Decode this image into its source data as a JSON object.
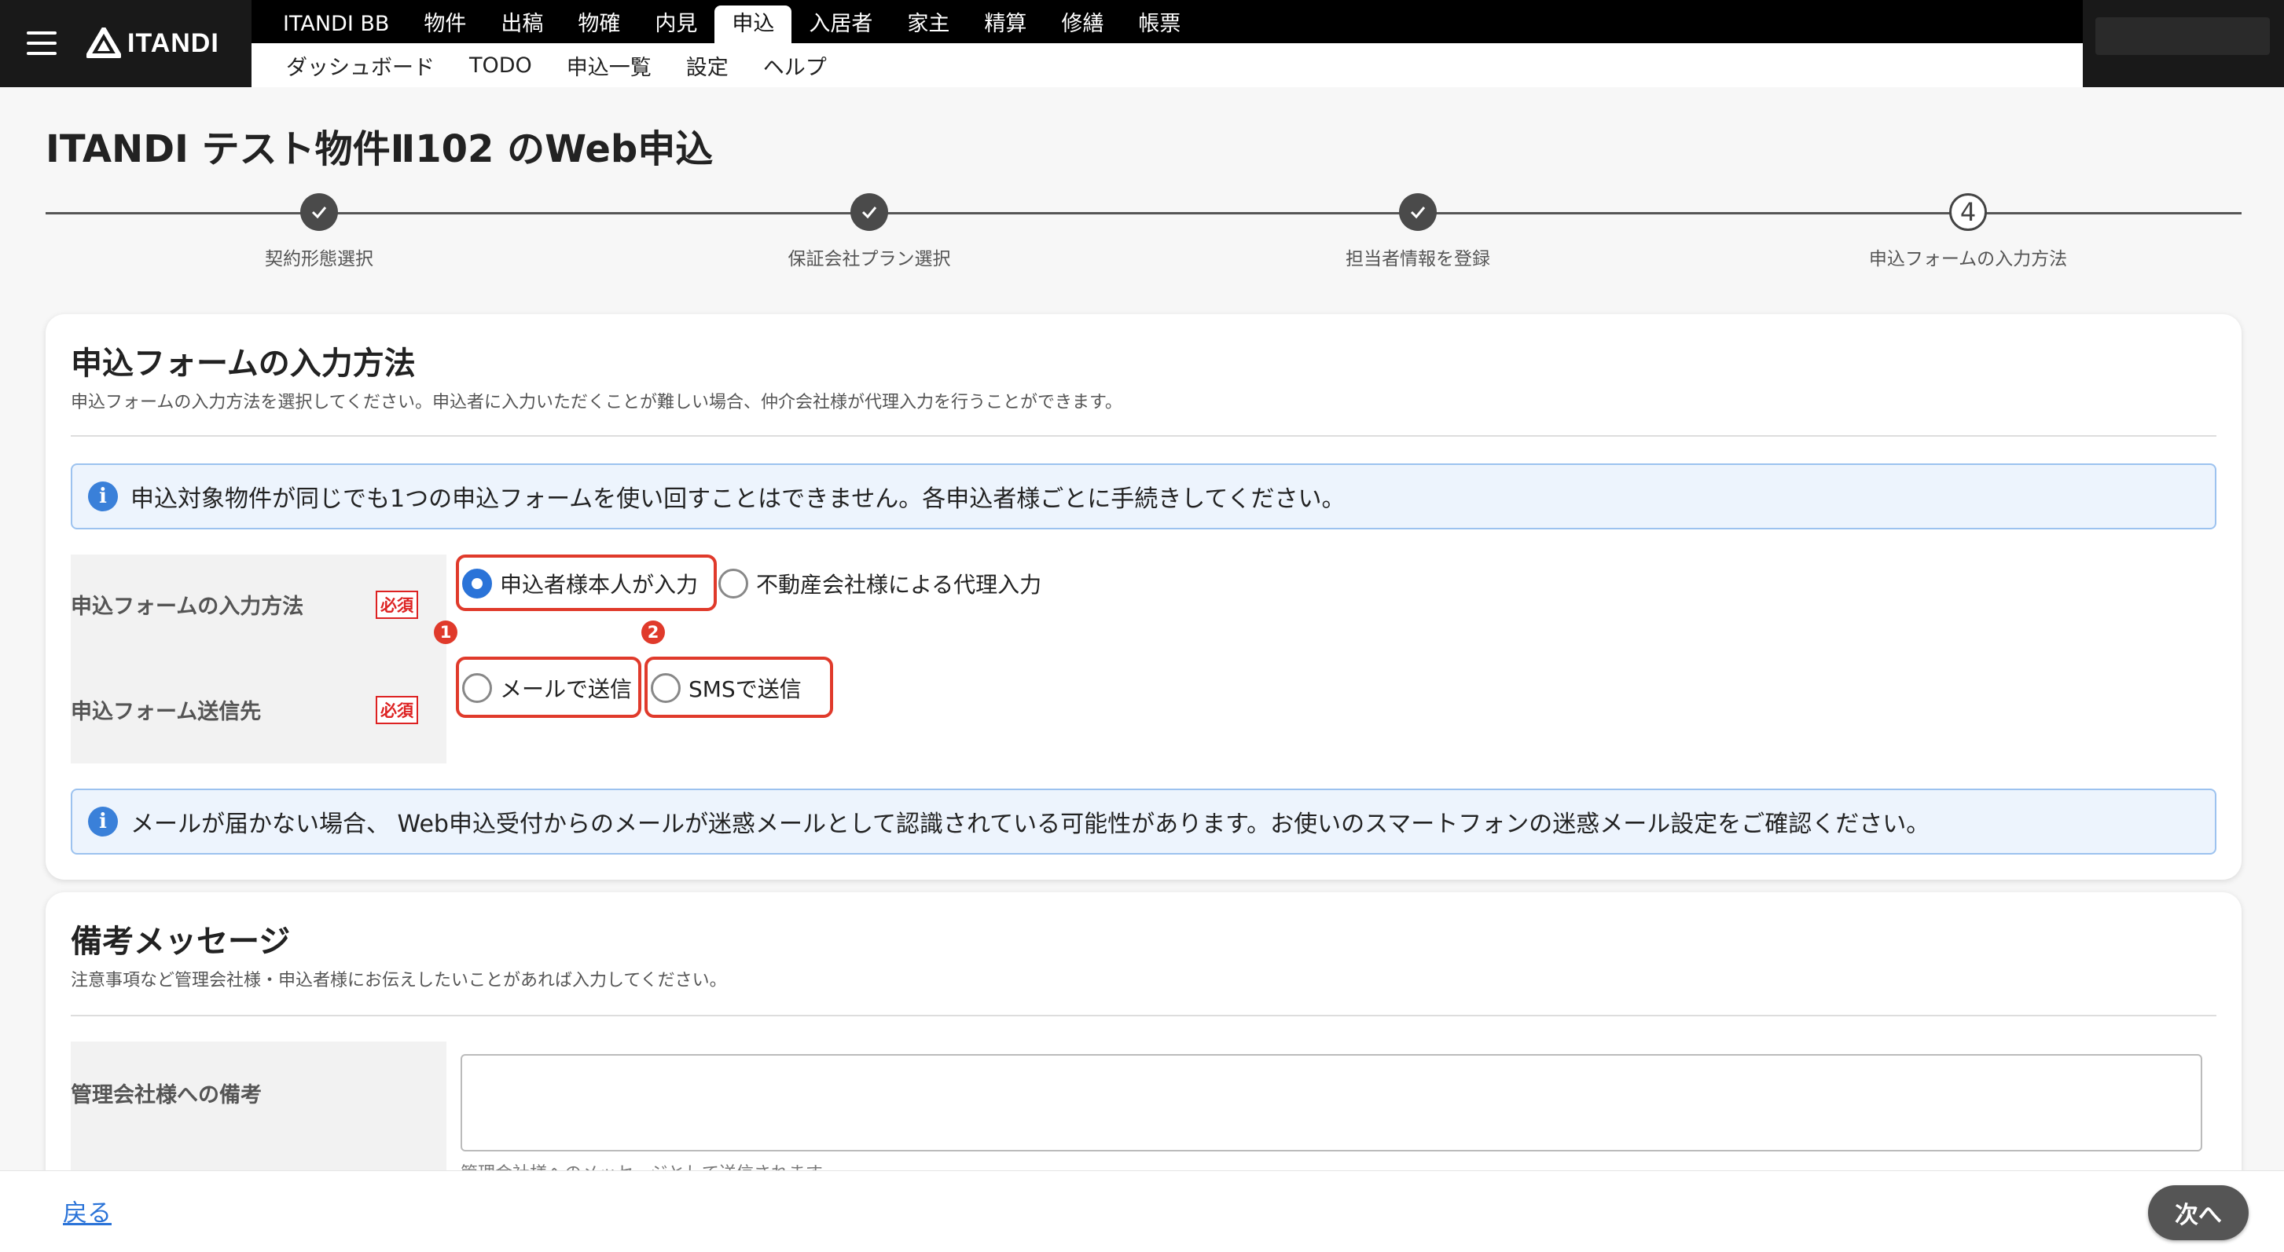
{
  "brand": {
    "logo_text": "ITANDI"
  },
  "nav_main": [
    {
      "label": "ITANDI BB",
      "active": false
    },
    {
      "label": "物件",
      "active": false
    },
    {
      "label": "出稿",
      "active": false
    },
    {
      "label": "物確",
      "active": false
    },
    {
      "label": "内見",
      "active": false
    },
    {
      "label": "申込",
      "active": true
    },
    {
      "label": "入居者",
      "active": false
    },
    {
      "label": "家主",
      "active": false
    },
    {
      "label": "精算",
      "active": false
    },
    {
      "label": "修繕",
      "active": false
    },
    {
      "label": "帳票",
      "active": false
    }
  ],
  "nav_sub": [
    "ダッシュボード",
    "TODO",
    "申込一覧",
    "設定",
    "ヘルプ"
  ],
  "page_title": "ITANDI テスト物件Ⅱ102 のWeb申込",
  "stepper": {
    "steps": [
      {
        "label": "契約形態選択",
        "status": "done"
      },
      {
        "label": "保証会社プラン選択",
        "status": "done"
      },
      {
        "label": "担当者情報を登録",
        "status": "done"
      },
      {
        "label": "申込フォームの入力方法",
        "status": "current",
        "number": "4"
      }
    ]
  },
  "input_method_card": {
    "title": "申込フォームの入力方法",
    "description": "申込フォームの入力方法を選択してください。申込者に入力いただくことが難しい場合、仲介会社様が代理入力を行うことができます。",
    "info_top": "申込対象物件が同じでも1つの申込フォームを使い回すことはできません。各申込者様ごとに手続きしてください。",
    "fields": [
      {
        "label": "申込フォームの入力方法",
        "required": "必須",
        "options": [
          {
            "label": "申込者様本人が入力",
            "checked": true
          },
          {
            "label": "不動産会社様による代理入力",
            "checked": false
          }
        ]
      },
      {
        "label": "申込フォーム送信先",
        "required": "必須",
        "options": [
          {
            "label": "メールで送信",
            "checked": false
          },
          {
            "label": "SMSで送信",
            "checked": false
          }
        ]
      }
    ],
    "markers": [
      "1",
      "2"
    ],
    "info_bottom": "メールが届かない場合、 Web申込受付からのメールが迷惑メールとして認識されている可能性があります。お使いのスマートフォンの迷惑メール設定をご確認ください。"
  },
  "remarks_card": {
    "title": "備考メッセージ",
    "description": "注意事項など管理会社様・申込者様にお伝えしたいことがあれば入力してください。",
    "field_label": "管理会社様への備考",
    "textarea_value": "",
    "hint": "管理会社様へのメッセージとして送信されます"
  },
  "footer": {
    "back_label": "戻る",
    "next_label": "次へ"
  },
  "colors": {
    "accent": "#2a73d8",
    "highlight": "#e03a2b",
    "topbar": "#191919"
  },
  "icons": [
    "menu-icon",
    "itandi-logo-icon",
    "check-icon",
    "info-icon"
  ]
}
